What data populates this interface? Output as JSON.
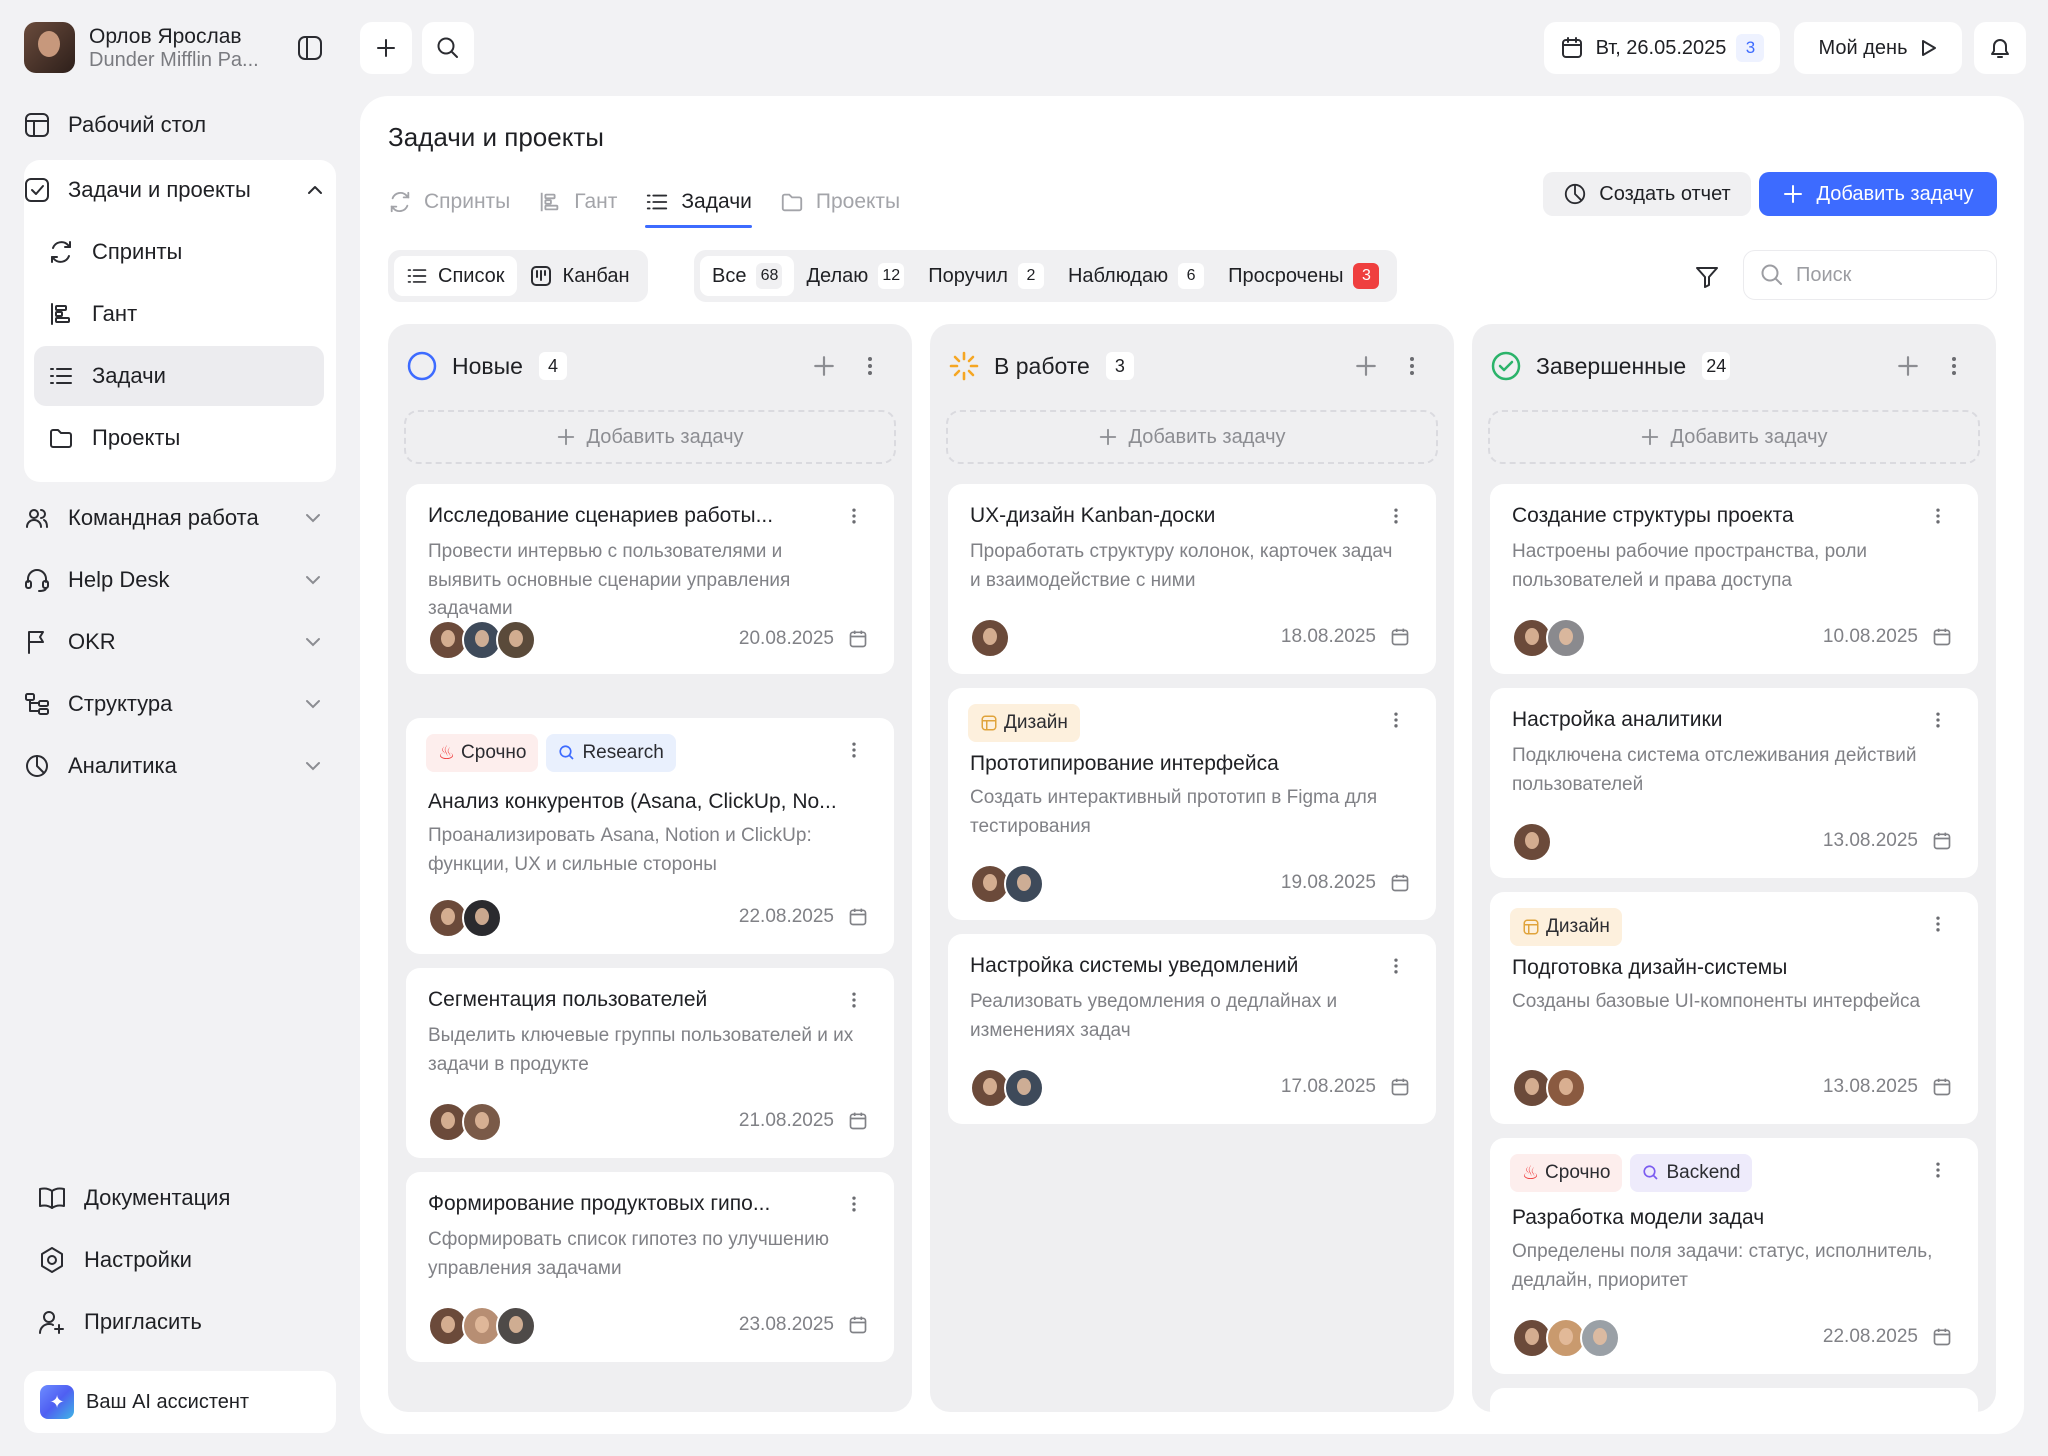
{
  "user": {
    "name": "Орлов Ярослав",
    "org": "Dunder Mifflin Pa..."
  },
  "sidebar": {
    "desktop": "Рабочий стол",
    "tasks_group": "Задачи и проекты",
    "sub": [
      "Спринты",
      "Гант",
      "Задачи",
      "Проекты"
    ],
    "items": [
      "Командная работа",
      "Help Desk",
      "OKR",
      "Структура",
      "Аналитика"
    ],
    "bottom": [
      "Документация",
      "Настройки",
      "Пригласить"
    ],
    "ai": "Ваш AI ассистент"
  },
  "topbar": {
    "date": "Вт, 26.05.2025",
    "date_count": "3",
    "my_day": "Мой день"
  },
  "page": {
    "title": "Задачи и проекты",
    "tabs": [
      "Спринты",
      "Гант",
      "Задачи",
      "Проекты"
    ],
    "create_report": "Создать отчет",
    "add_task": "Добавить задачу",
    "views": [
      "Список",
      "Канбан"
    ],
    "filters": [
      {
        "label": "Все",
        "count": "68"
      },
      {
        "label": "Делаю",
        "count": "12"
      },
      {
        "label": "Поручил",
        "count": "2"
      },
      {
        "label": "Наблюдаю",
        "count": "6"
      },
      {
        "label": "Просрочены",
        "count": "3"
      }
    ],
    "search_placeholder": "Поиск"
  },
  "columns": [
    {
      "title": "Новые",
      "count": "4",
      "add": "Добавить задачу",
      "cards": [
        {
          "title": "Исследование сценариев работы...",
          "desc": "Провести интервью с пользователями и выявить основные сценарии управления задачами",
          "date": "20.08.2025"
        },
        {
          "tags": [
            "Срочно",
            "Research"
          ],
          "title": "Анализ конкурентов (Asana, ClickUp, No...",
          "desc": "Проанализировать Asana, Notion и ClickUp: функции, UX и сильные стороны",
          "date": "22.08.2025"
        },
        {
          "title": "Сегментация пользователей",
          "desc": "Выделить ключевые группы пользователей и их задачи в продукте",
          "date": "21.08.2025"
        },
        {
          "title": "Формирование продуктовых гипо...",
          "desc": "Сформировать список гипотез по улучшению управления задачами",
          "date": "23.08.2025"
        }
      ]
    },
    {
      "title": "В работе",
      "count": "3",
      "add": "Добавить задачу",
      "cards": [
        {
          "title": "UX-дизайн Kanban-доски",
          "desc": "Проработать структуру колонок, карточек задач и взаимодействие с ними",
          "date": "18.08.2025"
        },
        {
          "tags": [
            "Дизайн"
          ],
          "title": "Прототипирование интерфейса",
          "desc": "Создать интерактивный прототип в Figma для тестирования",
          "date": "19.08.2025"
        },
        {
          "title": "Настройка системы уведомлений",
          "desc": "Реализовать уведомления о дедлайнах и изменениях задач",
          "date": "17.08.2025"
        }
      ]
    },
    {
      "title": "Завершенные",
      "count": "24",
      "add": "Добавить задачу",
      "cards": [
        {
          "title": "Создание структуры проекта",
          "desc": "Настроены рабочие пространства, роли пользователей и права доступа",
          "date": "10.08.2025"
        },
        {
          "title": "Настройка аналитики",
          "desc": "Подключена система отслеживания действий пользователей",
          "date": "13.08.2025"
        },
        {
          "tags": [
            "Дизайн"
          ],
          "title": "Подготовка дизайн-системы",
          "desc": "Созданы базовые UI-компоненты интерфейса",
          "date": "13.08.2025"
        },
        {
          "tags": [
            "Срочно",
            "Backend"
          ],
          "title": "Разработка модели задач",
          "desc": "Определены поля задачи: статус, исполнитель, дедлайн, приоритет",
          "date": "22.08.2025"
        }
      ]
    }
  ],
  "colors": {
    "accent": "#3d6bff",
    "overdue": "#ef3f3f",
    "done": "#2bb36a",
    "in_progress": "#f5a623"
  }
}
